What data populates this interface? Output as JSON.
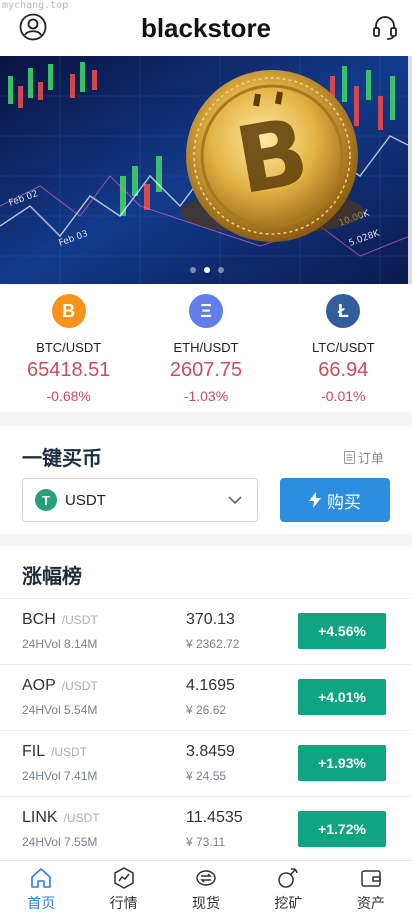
{
  "watermark": "mychang.top",
  "header": {
    "title": "blackstore",
    "left_icon": "user-circle-icon",
    "right_icon": "headset-icon"
  },
  "banner": {
    "slide_count": 3,
    "active_slide": 2
  },
  "tickers": [
    {
      "symbol": "B",
      "pair": "BTC/USDT",
      "price": "65418.51",
      "change": "-0.68%",
      "color": "#f7931a"
    },
    {
      "symbol": "Ξ",
      "pair": "ETH/USDT",
      "price": "2607.75",
      "change": "-1.03%",
      "color": "#627eea"
    },
    {
      "symbol": "Ł",
      "pair": "LTC/USDT",
      "price": "66.94",
      "change": "-0.01%",
      "color": "#345d9d"
    }
  ],
  "quick_buy": {
    "title": "一键买币",
    "orders_label": "订单",
    "currency_icon": "T",
    "currency": "USDT",
    "buy_label": "购买"
  },
  "gainers": {
    "title": "涨幅榜",
    "rows": [
      {
        "base": "BCH",
        "quote": "/USDT",
        "vol": "24HVol 8.14M",
        "last": "370.13",
        "cny": "¥ 2362.72",
        "change": "+4.56%"
      },
      {
        "base": "AOP",
        "quote": "/USDT",
        "vol": "24HVol 5.54M",
        "last": "4.1695",
        "cny": "¥ 26.62",
        "change": "+4.01%"
      },
      {
        "base": "FIL",
        "quote": "/USDT",
        "vol": "24HVol 7.41M",
        "last": "3.8459",
        "cny": "¥ 24.55",
        "change": "+1.93%"
      },
      {
        "base": "LINK",
        "quote": "/USDT",
        "vol": "24HVol 7.55M",
        "last": "11.4535",
        "cny": "¥ 73.11",
        "change": "+1.72%"
      }
    ]
  },
  "tabbar": [
    {
      "label": "首页",
      "icon": "home-icon",
      "active": true
    },
    {
      "label": "行情",
      "icon": "market-icon",
      "active": false
    },
    {
      "label": "现货",
      "icon": "spot-icon",
      "active": false
    },
    {
      "label": "挖矿",
      "icon": "mining-icon",
      "active": false
    },
    {
      "label": "资产",
      "icon": "wallet-icon",
      "active": false
    }
  ],
  "colors": {
    "accent": "#2d8ee0",
    "up": "#10a582",
    "down": "#c94d5e",
    "tab_active": "#2d7ce0"
  }
}
